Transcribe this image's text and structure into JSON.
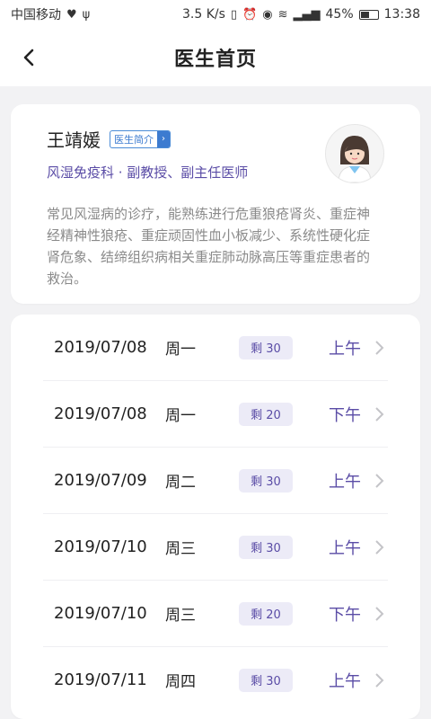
{
  "status_bar": {
    "carrier": "中国移动",
    "speed": "3.5 K/s",
    "battery": "45%",
    "time": "13:38"
  },
  "header": {
    "title": "医生首页"
  },
  "doctor": {
    "name": "王靖媛",
    "intro_tag": "医生简介",
    "subtitle": "风湿免疫科 · 副教授、副主任医师",
    "description": "常见风湿病的诊疗，能熟练进行危重狼疮肾炎、重症神经精神性狼疮、重症顽固性血小板减少、系统性硬化症肾危象、结缔组织病相关重症肺动脉高压等重症患者的救治。"
  },
  "schedule": [
    {
      "date": "2019/07/08",
      "weekday": "周一",
      "remain": "剩 30",
      "period": "上午"
    },
    {
      "date": "2019/07/08",
      "weekday": "周一",
      "remain": "剩 20",
      "period": "下午"
    },
    {
      "date": "2019/07/09",
      "weekday": "周二",
      "remain": "剩 30",
      "period": "上午"
    },
    {
      "date": "2019/07/10",
      "weekday": "周三",
      "remain": "剩 30",
      "period": "上午"
    },
    {
      "date": "2019/07/10",
      "weekday": "周三",
      "remain": "剩 20",
      "period": "下午"
    },
    {
      "date": "2019/07/11",
      "weekday": "周四",
      "remain": "剩 30",
      "period": "上午"
    }
  ],
  "colors": {
    "accent": "#5a4ca6",
    "tag_blue": "#3c7bd0",
    "bg": "#f2f2f4"
  }
}
